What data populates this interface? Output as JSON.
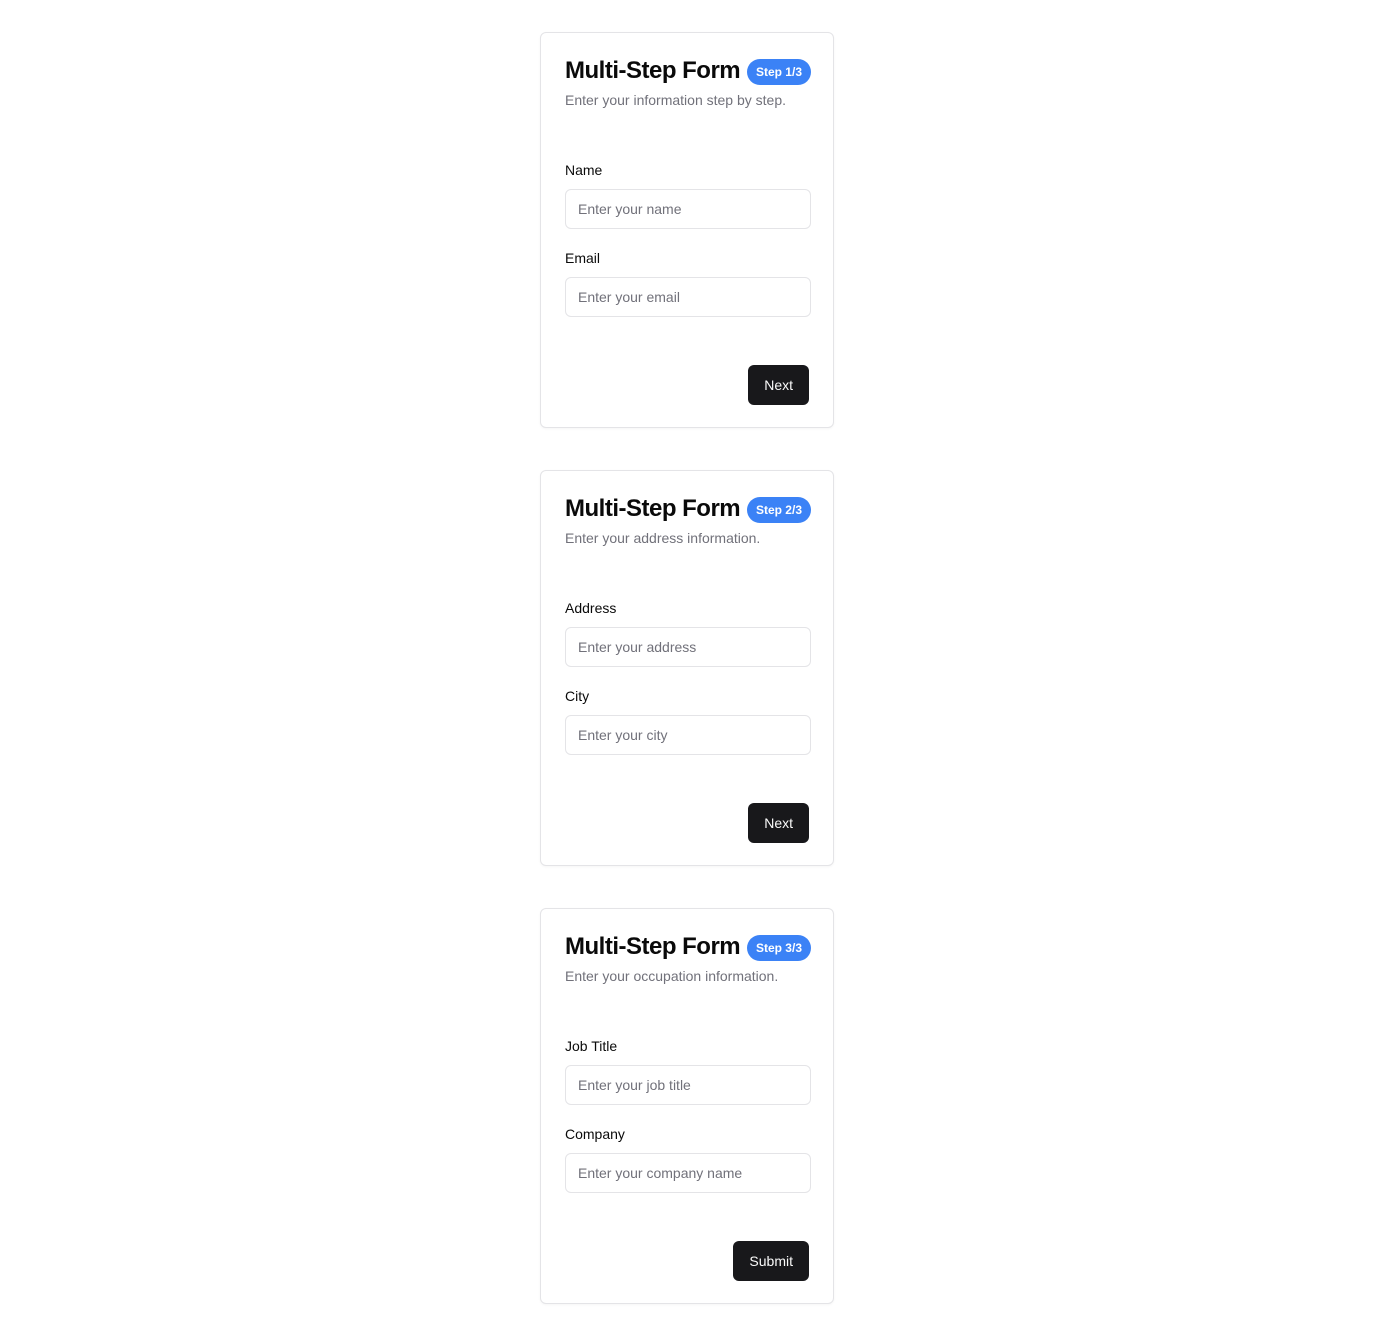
{
  "forms": [
    {
      "title": "Multi-Step Form",
      "badge": "Step 1/3",
      "description": "Enter your information step by step.",
      "fields": [
        {
          "label": "Name",
          "placeholder": "Enter your name",
          "value": ""
        },
        {
          "label": "Email",
          "placeholder": "Enter your email",
          "value": ""
        }
      ],
      "button": "Next"
    },
    {
      "title": "Multi-Step Form",
      "badge": "Step 2/3",
      "description": "Enter your address information.",
      "fields": [
        {
          "label": "Address",
          "placeholder": "Enter your address",
          "value": ""
        },
        {
          "label": "City",
          "placeholder": "Enter your city",
          "value": ""
        }
      ],
      "button": "Next"
    },
    {
      "title": "Multi-Step Form",
      "badge": "Step 3/3",
      "description": "Enter your occupation information.",
      "fields": [
        {
          "label": "Job Title",
          "placeholder": "Enter your job title",
          "value": ""
        },
        {
          "label": "Company",
          "placeholder": "Enter your company name",
          "value": ""
        }
      ],
      "button": "Submit"
    }
  ],
  "colors": {
    "badge": "#3b82f6",
    "button": "#18181b",
    "border": "#e4e4e7",
    "muted_text": "#71717a"
  }
}
